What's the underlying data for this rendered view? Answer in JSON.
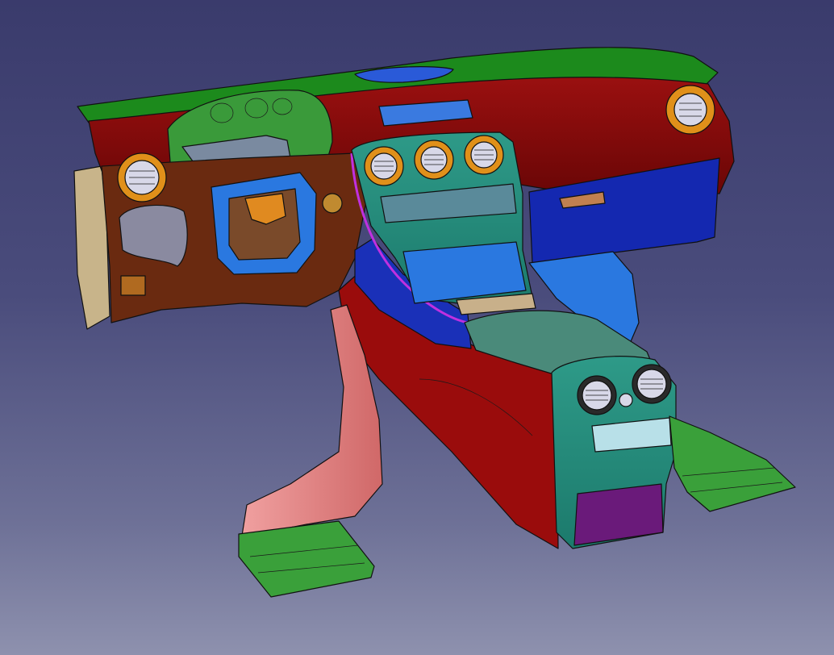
{
  "viewport": {
    "background_top": "#3a3b6c",
    "background_bottom": "#8e91ae"
  },
  "model": {
    "part_colors": {
      "dashboard_upper": "#8a0a0a",
      "top_cover": "#1c8a1c",
      "cluster_frame": "#3a9a3a",
      "lower_panel": "#6a2a10",
      "center_stack": "#2a8a7a",
      "glovebox": "#1428b0",
      "steering_bracket": "#2a78e0",
      "console_side": "#9a0c0c",
      "armrest": "#4a8a7a",
      "rear_console": "#1f8f7f",
      "rear_storage": "#6a1a7a",
      "support_leg": "#e07a7a",
      "floor_duct": "#3aa03a",
      "side_trim": "#c8b48a",
      "vent_ring": "#e0901a",
      "ambient_strip": "#c030e0"
    }
  }
}
